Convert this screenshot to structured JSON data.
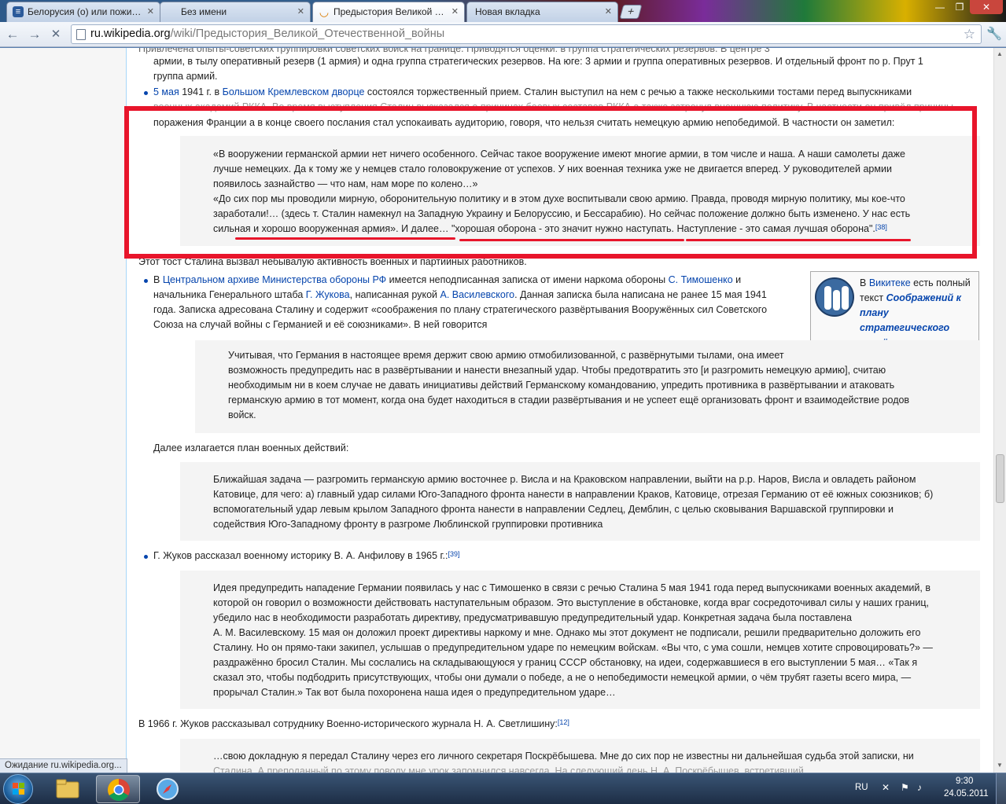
{
  "browser": {
    "tabs": [
      {
        "label": "Белорусия (о) или пожи…",
        "favicon": "page-icon"
      },
      {
        "label": "Без имени",
        "favicon": "blank"
      },
      {
        "label": "Предыстория Великой …",
        "favicon": "loading-icon"
      },
      {
        "label": "Новая вкладка",
        "favicon": "blank"
      }
    ],
    "new_tab_label": "+",
    "url_host": "ru.wikipedia.org",
    "url_path": "/wiki/Предыстория_Великой_Отечественной_войны",
    "status": "Ожидание ru.wikipedia.org..."
  },
  "article": {
    "top_line_1": "армии, в тылу оперативный резерв (1 армия) и одна группа стратегических резервов. На юге: 3 армии и группа оперативных резервов. И отдельный фронт по р. Прут 1",
    "top_line_2": "группа армий.",
    "b1_date": "5 мая",
    "b1_mid": " 1941 г. в ",
    "b1_link": "Большом Кремлевском дворце",
    "b1_rest": " состоялся торжественный прием. Сталин выступил на нем с речью а также несколькими тостами перед выпускниками",
    "b1_line3": "поражения Франции а в конце своего послания стал успокаивать аудиторию, говоря, что нельзя считать немецкую армию непобедимой. В частности он заметил:",
    "q1": [
      "«В вооружении германской армии нет ничего особенного. Сейчас такое вооружение имеют многие армии, в том числе и наша. А наши самолеты даже",
      "лучше немецких. Да к тому же у немцев стало головокружение от успехов. У них военная техника уже не двигается вперед. У руководителей армии",
      "появилось зазнайство — что нам, нам море по колено…»",
      "«До сих пор мы проводили мирную, оборонительную политику и в этом духе воспитывали свою армию. Правда, проводя мирную политику, мы кое-что",
      "заработали!… (здесь т. Сталин намекнул на Западную Украину и Белоруссию, и Бессарабию). Но сейчас положение должно быть изменено. У нас есть",
      "сильная и хорошо вооруженная армия». И далее… \"хорошая оборона - это значит нужно наступать. Наступление - это самая лучшая оборона\"."
    ],
    "q1_ref": "[38]",
    "after_q1": "Этот тост Сталина вызвал небывалую активность военных и партийных работников.",
    "b2": {
      "t1": "В ",
      "l1": "Центральном архиве Министерства обороны РФ",
      "t2": " имеется неподписанная записка от имени наркома обороны ",
      "l2": "С. Тимошенко",
      "t3": " и",
      "t4": "начальника Генерального штаба ",
      "l3": "Г. Жукова",
      "t5": ", написанная рукой ",
      "l4": "А. Василевского",
      "t6": ". Данная записка была написана не ранее 15 мая 1941",
      "line3": "года. Записка адресована Сталину и содержит «соображения по плану стратегического развёртывания Вооружённых сил Советского",
      "line4": "Союза на случай войны с Германией и её союзниками». В ней говорится"
    },
    "q2": [
      "Учитывая, что Германия в настоящее время держит свою армию отмобилизованной, с развёрнутыми тылами, она имеет",
      "возможность предупредить нас в развёртывании и нанести внезапный удар. Чтобы предотвратить это [и разгромить немецкую армию], считаю",
      "необходимым ни в коем случае не давать инициативы действий Германскому командованию, упредить противника в развёртывании и атаковать",
      "германскую армию в тот момент, когда она будет находиться в стадии развёртывания и не успеет ещё организовать фронт и взаимодействие родов",
      "войск."
    ],
    "plan_intro": "Далее излагается план военных действий:",
    "q3": [
      "Ближайшая задача — разгромить германскую армию восточнее р. Висла и на Краковском направлении, выйти на р.р. Наров, Висла и овладеть районом",
      "Катовице, для чего: а) главный удар силами Юго-Западного фронта нанести в направлении Краков, Катовице, отрезая Германию от её южных союзников; б)",
      "вспомогательный удар левым крылом Западного фронта нанести в направлении Седлец, Демблин, с целью сковывания Варшавской группировки и",
      "содействия Юго-Западному фронту в разгроме Люблинской группировки противника"
    ],
    "b3": "Г. Жуков рассказал военному историку В. А. Анфилову в 1965 г.:",
    "b3_ref": "[39]",
    "q4": [
      "Идея предупредить нападение Германии появилась у нас с Тимошенко в связи с речью Сталина 5 мая 1941 года перед выпускниками военных академий, в",
      "которой он говорил о возможности действовать наступательным образом. Это выступление в обстановке, когда враг сосредоточивал силы у наших границ,",
      "убедило нас в необходимости разработать директиву, предусматривавшую предупредительный удар. Конкретная задача была поставлена",
      "А. М. Василевскому. 15 мая он доложил проект директивы наркому и мне. Однако мы этот документ не подписали, решили предварительно доложить его",
      "Сталину. Но он прямо-таки закипел, услышав о предупредительном ударе по немецким войскам. «Вы что, с ума сошли, немцев хотите спровоцировать?» —",
      "раздражённо бросил Сталин. Мы сослались на складывающуюся у границ СССР обстановку, на идеи, содержавшиеся в его выступлении 5 мая… «Так я",
      "сказал это, чтобы подбодрить присутствующих, чтобы они думали о победе, а не о непобедимости немецкой армии, о чём трубят газеты всего мира, —",
      "прорычал Сталин.» Так вот была похоронена наша идея о предупредительном ударе…"
    ],
    "p1966": "В 1966 г. Жуков рассказывал сотруднику Военно-исторического журнала Н. А. Светлишину:",
    "p1966_ref": "[12]",
    "q5_line1": "…свою докладную я передал Сталину через его личного секретаря Поскрёбышева. Мне до сих пор не известны ни дальнейшая судьба этой записки, ни"
  },
  "sidebox": {
    "t1": "В ",
    "link": "Викитеке",
    "t2": " есть полный текст ",
    "title": "Соображений к плану стратегического развёртывания…"
  },
  "taskbar": {
    "lang": "RU",
    "time": "9:30",
    "date": "24.05.2011"
  },
  "colors": {
    "annotation_red": "#e8152b",
    "link_blue": "#0645ad"
  }
}
